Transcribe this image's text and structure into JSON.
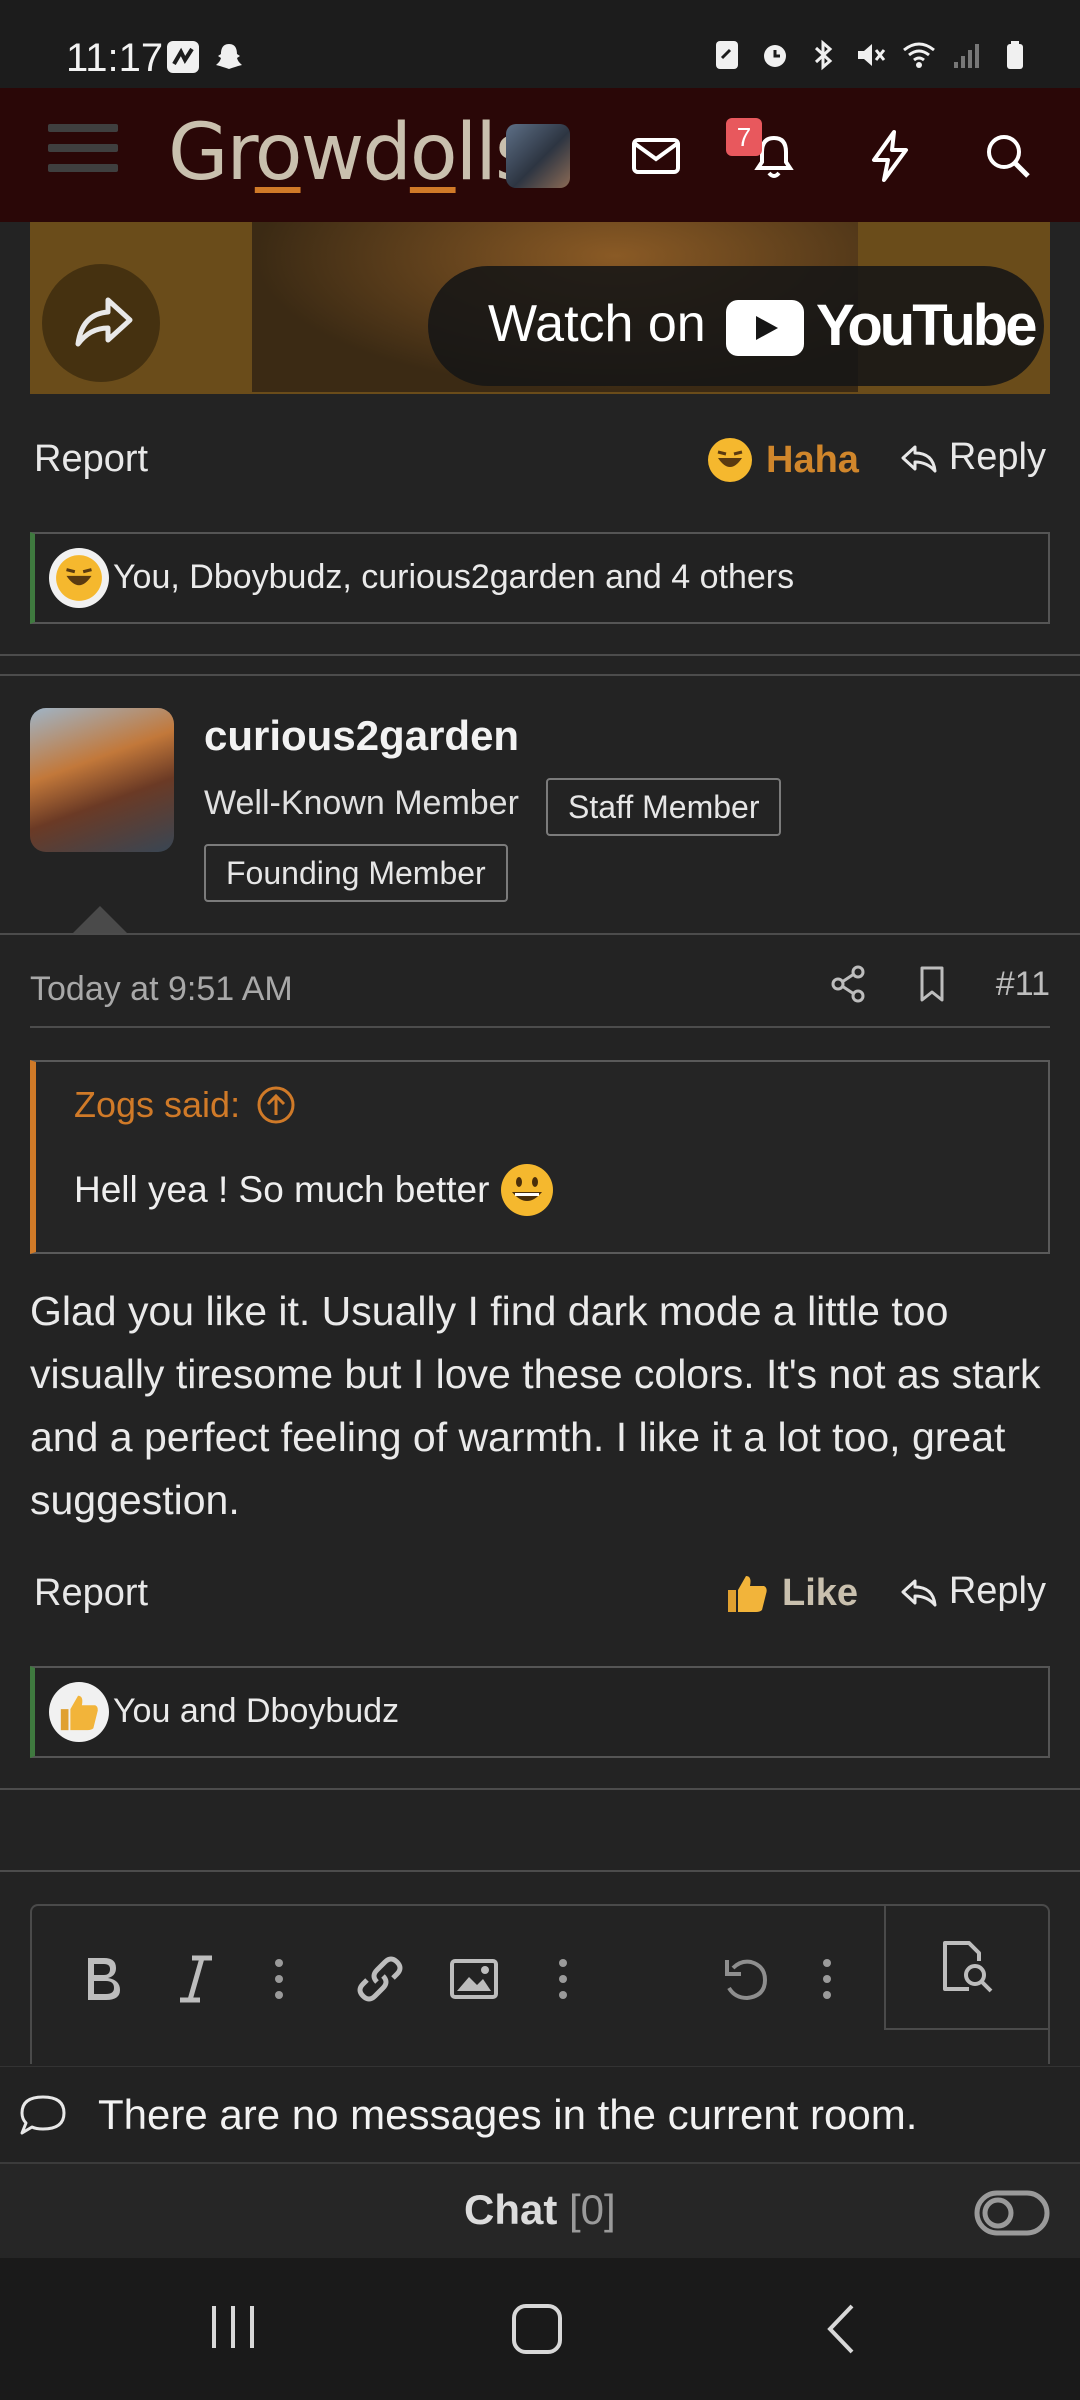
{
  "status_bar": {
    "time": "11:17",
    "left_icons": [
      "bolt-app-icon",
      "snapchat-icon"
    ],
    "right_icons": [
      "screenshot-icon",
      "alarm-icon",
      "bluetooth-icon",
      "mute-icon",
      "wifi-icon",
      "signal-icon",
      "battery-icon"
    ]
  },
  "header": {
    "logo_parts": [
      "Gr",
      "o",
      "wd",
      "o",
      "lls"
    ],
    "notification_count": "7",
    "icons": [
      "menu-icon",
      "mail-icon",
      "bell-icon",
      "bolt-icon",
      "search-icon"
    ]
  },
  "video": {
    "watch_on": "Watch on",
    "platform": "YouTube"
  },
  "post1": {
    "report": "Report",
    "reaction_label": "Haha",
    "reaction_color": "#d0862b",
    "reply": "Reply",
    "reactions_summary": "You, Dboybudz, curious2garden and 4 others"
  },
  "post2": {
    "username": "curious2garden",
    "title": "Well-Known Member",
    "badges": [
      "Staff Member",
      "Founding Member"
    ],
    "date": "Today at 9:51 AM",
    "post_number": "#11",
    "quote": {
      "author_said": "Zogs said:",
      "text": "Hell yea ! So much better"
    },
    "body": "Glad you like it. Usually I find dark mode a little too visually tiresome but I love these colors. It's not as stark and a perfect feeling of warmth. I like it a lot too, great suggestion.",
    "report": "Report",
    "reaction_label": "Like",
    "reaction_color": "#c9c0ae",
    "reply": "Reply",
    "reactions_summary": "You and Dboybudz"
  },
  "editor": {
    "tools": [
      "bold",
      "italic",
      "more",
      "link",
      "image",
      "more",
      "undo",
      "more",
      "preview"
    ]
  },
  "chat": {
    "empty_message": "There are no messages in the current room.",
    "label": "Chat",
    "count": "[0]"
  },
  "accent_color": "#d07a28",
  "header_color": "#2a0707"
}
